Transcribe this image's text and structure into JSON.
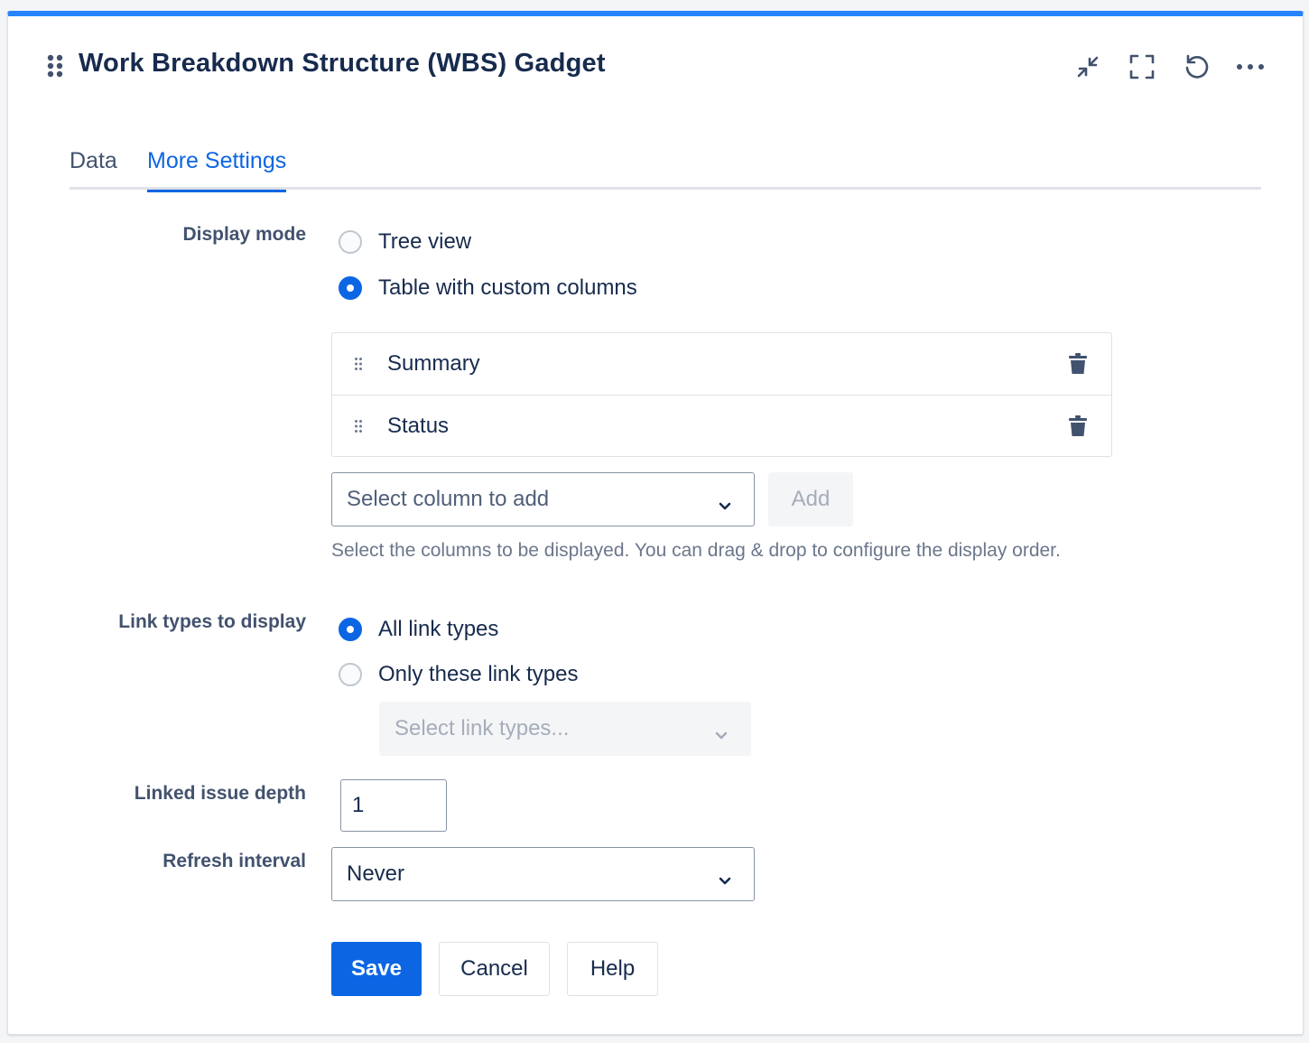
{
  "header": {
    "title": "Work Breakdown Structure (WBS) Gadget",
    "icons": [
      "drag-handle-icon",
      "collapse-icon",
      "fullscreen-icon",
      "refresh-icon",
      "more-icon"
    ]
  },
  "tabs": [
    {
      "label": "Data",
      "active": false
    },
    {
      "label": "More Settings",
      "active": true
    }
  ],
  "display_mode": {
    "label": "Display mode",
    "options": [
      {
        "label": "Tree view",
        "checked": false
      },
      {
        "label": "Table with custom columns",
        "checked": true
      }
    ],
    "columns": [
      {
        "name": "Summary"
      },
      {
        "name": "Status"
      }
    ],
    "column_select_placeholder": "Select column to add",
    "add_label": "Add",
    "hint": "Select the columns to be displayed. You can drag & drop to configure the display order."
  },
  "link_types": {
    "label": "Link types to display",
    "options": [
      {
        "label": "All link types",
        "checked": true
      },
      {
        "label": "Only these link types",
        "checked": false
      }
    ],
    "select_placeholder": "Select link types..."
  },
  "linked_issue_depth": {
    "label": "Linked issue depth",
    "value": "1"
  },
  "refresh_interval": {
    "label": "Refresh interval",
    "value": "Never"
  },
  "actions": {
    "save": "Save",
    "cancel": "Cancel",
    "help": "Help"
  },
  "colors": {
    "accent": "#0c66e4",
    "top_border": "#2684ff"
  }
}
